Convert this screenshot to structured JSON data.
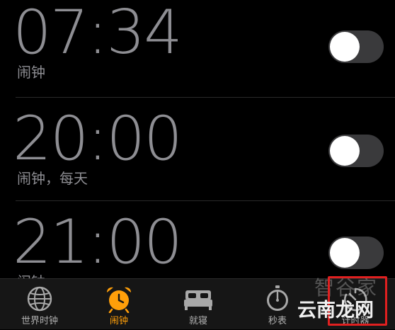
{
  "alarms": [
    {
      "time": "07:34",
      "label": "闹钟",
      "enabled": false
    },
    {
      "time": "20:00",
      "label": "闹钟，每天",
      "enabled": false
    },
    {
      "time": "21:00",
      "label": "闹钟",
      "enabled": false
    }
  ],
  "tabbar": {
    "active_color": "#ff9f0a",
    "items": [
      {
        "label": "世界时钟",
        "icon": "globe-icon",
        "active": false
      },
      {
        "label": "闹钟",
        "icon": "alarm-clock-icon",
        "active": true
      },
      {
        "label": "就寝",
        "icon": "bed-icon",
        "active": false
      },
      {
        "label": "秒表",
        "icon": "stopwatch-icon",
        "active": false
      },
      {
        "label": "计时器",
        "icon": "timer-icon",
        "active": false
      }
    ]
  },
  "watermark": {
    "top_text": "智谷家",
    "bottom_text": "云南龙网"
  }
}
